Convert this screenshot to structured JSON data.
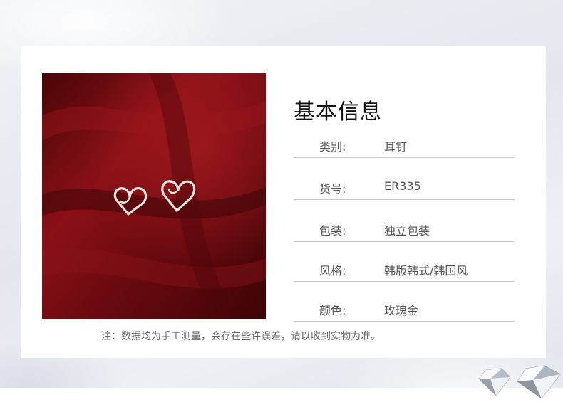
{
  "info": {
    "title": "基本信息",
    "rows": [
      {
        "label": "类别:",
        "value": "耳钉"
      },
      {
        "label": "货号:",
        "value": "ER335"
      },
      {
        "label": "包装:",
        "value": "独立包装"
      },
      {
        "label": "风格:",
        "value": "韩版韩式/韩国风"
      },
      {
        "label": "颜色:",
        "value": "玫瑰金"
      }
    ]
  },
  "note": "注：数据均为手工测量，会存在些许误差，请以收到实物为准。",
  "icons": {
    "product_image": "heart-stud-earrings-image",
    "decoration": "diamond-icon"
  },
  "colors": {
    "photo_background": "#6e0a0e",
    "text": "#555555",
    "title": "#111111",
    "divider": "#c9c9c9"
  }
}
